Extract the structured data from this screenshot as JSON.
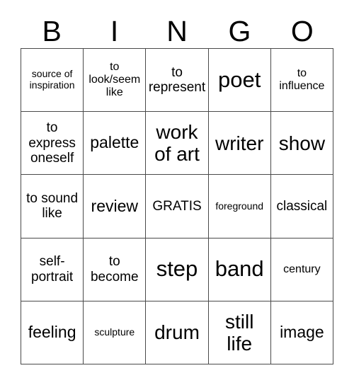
{
  "card": {
    "title": "BINGO",
    "header": {
      "letters": [
        "B",
        "I",
        "N",
        "G",
        "O"
      ]
    },
    "grid": {
      "rows": 5,
      "columns": 5,
      "border_color": "#4a4a4a",
      "background_color": "#ffffff",
      "text_color": "#000000",
      "cells": [
        [
          {
            "text": "source of inspiration",
            "size": "xs"
          },
          {
            "text": "to look/seem like",
            "size": "s"
          },
          {
            "text": "to represent",
            "size": "m"
          },
          {
            "text": "poet",
            "size": "xxl"
          },
          {
            "text": "to influence",
            "size": "s"
          }
        ],
        [
          {
            "text": "to express oneself",
            "size": "m"
          },
          {
            "text": "palette",
            "size": "l"
          },
          {
            "text": "work of art",
            "size": "xl"
          },
          {
            "text": "writer",
            "size": "xl"
          },
          {
            "text": "show",
            "size": "xl"
          }
        ],
        [
          {
            "text": "to sound like",
            "size": "m"
          },
          {
            "text": "review",
            "size": "l"
          },
          {
            "text": "GRATIS",
            "size": "m"
          },
          {
            "text": "foreground",
            "size": "xs"
          },
          {
            "text": "classical",
            "size": "m"
          }
        ],
        [
          {
            "text": "self-portrait",
            "size": "m"
          },
          {
            "text": "to become",
            "size": "m"
          },
          {
            "text": "step",
            "size": "xxl"
          },
          {
            "text": "band",
            "size": "xxl"
          },
          {
            "text": "century",
            "size": "s"
          }
        ],
        [
          {
            "text": "feeling",
            "size": "l"
          },
          {
            "text": "sculpture",
            "size": "xs"
          },
          {
            "text": "drum",
            "size": "xl"
          },
          {
            "text": "still life",
            "size": "xl"
          },
          {
            "text": "image",
            "size": "l"
          }
        ]
      ]
    }
  }
}
